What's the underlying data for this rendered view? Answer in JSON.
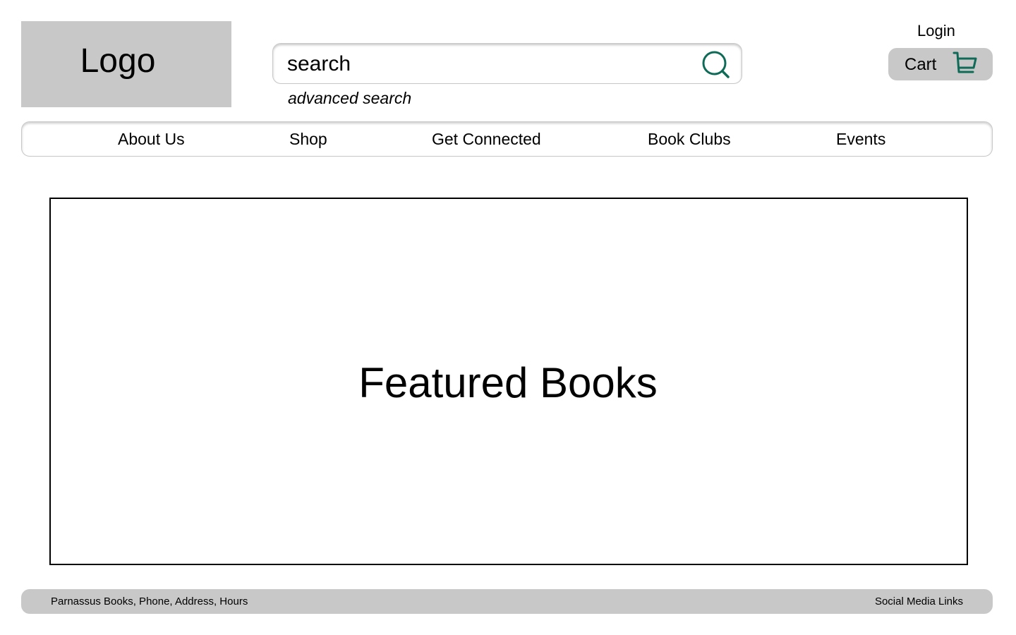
{
  "header": {
    "logo_text": "Logo",
    "search": {
      "placeholder": "search",
      "value": "",
      "icon": "search-icon",
      "advanced_label": "advanced search"
    },
    "login_label": "Login",
    "cart": {
      "label": "Cart",
      "icon": "cart-icon"
    }
  },
  "nav": {
    "items": [
      {
        "label": "About Us"
      },
      {
        "label": "Shop"
      },
      {
        "label": "Get Connected"
      },
      {
        "label": "Book Clubs"
      },
      {
        "label": "Events"
      }
    ]
  },
  "main": {
    "featured_title": "Featured Books"
  },
  "footer": {
    "info": "Parnassus Books, Phone, Address, Hours",
    "social": "Social Media Links"
  },
  "colors": {
    "panel_gray": "#c8c8c8",
    "icon_green": "#0f6b57",
    "text": "#000000",
    "background": "#ffffff"
  }
}
